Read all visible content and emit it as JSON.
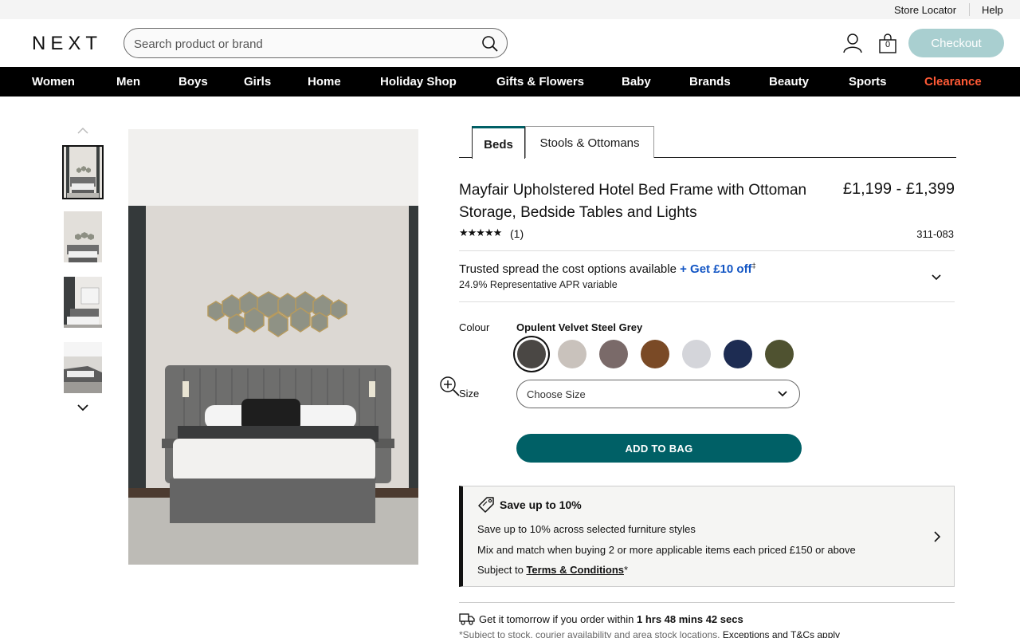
{
  "utility": {
    "store_locator": "Store Locator",
    "help": "Help"
  },
  "header": {
    "logo": "NEXT",
    "search_placeholder": "Search product or brand",
    "bag_count": "0",
    "checkout": "Checkout"
  },
  "nav": [
    "Women",
    "Men",
    "Boys",
    "Girls",
    "Home",
    "Holiday Shop",
    "Gifts & Flowers",
    "Baby",
    "Brands",
    "Beauty",
    "Sports",
    "Clearance"
  ],
  "tabs": [
    "Beds",
    "Stools & Ottomans"
  ],
  "product": {
    "title": "Mayfair Upholstered Hotel Bed Frame with Ottoman Storage, Bedside Tables and Lights",
    "price": "£1,199 - £1,399",
    "stars": "★★★★★",
    "rating": 5,
    "review_count": "(1)",
    "item_code": "311-083"
  },
  "finance": {
    "text": "Trusted spread the cost options available",
    "link": "+ Get £10 off",
    "sup": "‡",
    "apr": "24.9% Representative APR variable"
  },
  "colour": {
    "label": "Colour",
    "selected": "Opulent Velvet Steel Grey",
    "swatches": [
      "#4a4744",
      "#c9c2bc",
      "#7a6a69",
      "#7a4a26",
      "#d4d5da",
      "#1d2c52",
      "#4f5230"
    ]
  },
  "size": {
    "label": "Size",
    "placeholder": "Choose Size"
  },
  "add_to_bag": "ADD TO BAG",
  "promo": {
    "title": "Save up to 10%",
    "line1": "Save up to 10% across selected furniture styles",
    "line2": "Mix and match when buying 2 or more applicable items each priced £150 or above",
    "line3_prefix": "Subject to",
    "line3_link": "Terms & Conditions",
    "line3_suffix": "*"
  },
  "delivery": {
    "prefix": "Get it tomorrow if you order within",
    "countdown": "1 hrs 48 mins 42 secs",
    "note_prefix": "*Subject to stock, courier availability and area stock locations.",
    "note_link": "Exceptions and T&Cs apply"
  },
  "colors": {
    "teal": "#006066",
    "checkout": "#a9cfd0",
    "clearance": "#ff5a36",
    "link_blue": "#1255c4"
  }
}
